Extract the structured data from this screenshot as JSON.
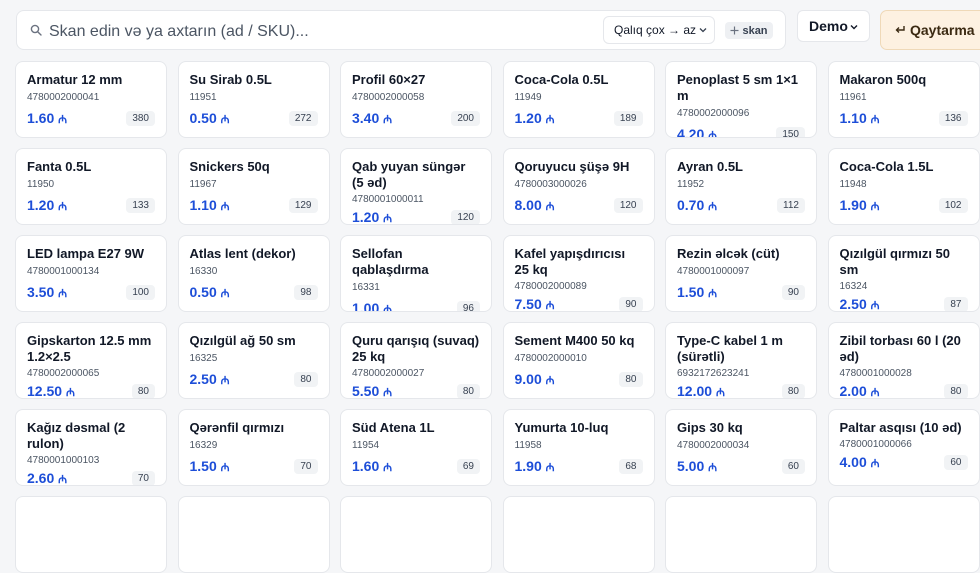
{
  "search": {
    "placeholder": "Skan edin və ya axtarın (ad / SKU)...",
    "sort_label": "Qalıq çox → az",
    "scan_label": "skan"
  },
  "header": {
    "demo_label": "Demo",
    "return_label": "Qaytarma"
  },
  "currency_symbol": "₼",
  "products": [
    {
      "name": "Armatur 12 mm",
      "sku": "4780002000041",
      "price": "1.60",
      "stock": "380"
    },
    {
      "name": "Su Sirab 0.5L",
      "sku": "11951",
      "price": "0.50",
      "stock": "272"
    },
    {
      "name": "Profil 60×27",
      "sku": "4780002000058",
      "price": "3.40",
      "stock": "200"
    },
    {
      "name": "Coca-Cola 0.5L",
      "sku": "11949",
      "price": "1.20",
      "stock": "189"
    },
    {
      "name": "Penoplast 5 sm 1×1 m",
      "sku": "4780002000096",
      "price": "4.20",
      "stock": "150"
    },
    {
      "name": "Makaron 500q",
      "sku": "11961",
      "price": "1.10",
      "stock": "136"
    },
    {
      "name": "Fanta 0.5L",
      "sku": "11950",
      "price": "1.20",
      "stock": "133"
    },
    {
      "name": "Snickers 50q",
      "sku": "11967",
      "price": "1.10",
      "stock": "129"
    },
    {
      "name": "Qab yuyan süngər (5 əd)",
      "sku": "4780001000011",
      "price": "1.20",
      "stock": "120"
    },
    {
      "name": "Qoruyucu şüşə 9H",
      "sku": "4780003000026",
      "price": "8.00",
      "stock": "120"
    },
    {
      "name": "Ayran 0.5L",
      "sku": "11952",
      "price": "0.70",
      "stock": "112"
    },
    {
      "name": "Coca-Cola 1.5L",
      "sku": "11948",
      "price": "1.90",
      "stock": "102"
    },
    {
      "name": "LED lampa E27 9W",
      "sku": "4780001000134",
      "price": "3.50",
      "stock": "100"
    },
    {
      "name": "Atlas lent (dekor)",
      "sku": "16330",
      "price": "0.50",
      "stock": "98"
    },
    {
      "name": "Sellofan qablaşdırma",
      "sku": "16331",
      "price": "1.00",
      "stock": "96"
    },
    {
      "name": "Kafel yapışdırıcısı 25 kq",
      "sku": "4780002000089",
      "price": "7.50",
      "stock": "90"
    },
    {
      "name": "Rezin əlcək (cüt)",
      "sku": "4780001000097",
      "price": "1.50",
      "stock": "90"
    },
    {
      "name": "Qızılgül qırmızı 50 sm",
      "sku": "16324",
      "price": "2.50",
      "stock": "87"
    },
    {
      "name": "Gipskarton 12.5 mm 1.2×2.5",
      "sku": "4780002000065",
      "price": "12.50",
      "stock": "80"
    },
    {
      "name": "Qızılgül ağ 50 sm",
      "sku": "16325",
      "price": "2.50",
      "stock": "80"
    },
    {
      "name": "Quru qarışıq (suvaq) 25 kq",
      "sku": "4780002000027",
      "price": "5.50",
      "stock": "80"
    },
    {
      "name": "Sement M400 50 kq",
      "sku": "4780002000010",
      "price": "9.00",
      "stock": "80"
    },
    {
      "name": "Type-C kabel 1 m (sürətli)",
      "sku": "6932172623241",
      "price": "12.00",
      "stock": "80"
    },
    {
      "name": "Zibil torbası 60 l (20 əd)",
      "sku": "4780001000028",
      "price": "2.00",
      "stock": "80"
    },
    {
      "name": "Kağız dəsmal (2 rulon)",
      "sku": "4780001000103",
      "price": "2.60",
      "stock": "70"
    },
    {
      "name": "Qərənfil qırmızı",
      "sku": "16329",
      "price": "1.50",
      "stock": "70"
    },
    {
      "name": "Süd Atena 1L",
      "sku": "11954",
      "price": "1.60",
      "stock": "69"
    },
    {
      "name": "Yumurta 10-luq",
      "sku": "11958",
      "price": "1.90",
      "stock": "68"
    },
    {
      "name": "Gips 30 kq",
      "sku": "4780002000034",
      "price": "5.00",
      "stock": "60"
    },
    {
      "name": "Paltar asqısı (10 əd)",
      "sku": "4780001000066",
      "price": "4.00",
      "stock": "60"
    },
    {
      "name": "",
      "sku": "",
      "price": "",
      "stock": ""
    },
    {
      "name": "",
      "sku": "",
      "price": "",
      "stock": ""
    },
    {
      "name": "",
      "sku": "",
      "price": "",
      "stock": ""
    },
    {
      "name": "",
      "sku": "",
      "price": "",
      "stock": ""
    },
    {
      "name": "",
      "sku": "",
      "price": "",
      "stock": ""
    },
    {
      "name": "",
      "sku": "",
      "price": "",
      "stock": ""
    }
  ]
}
